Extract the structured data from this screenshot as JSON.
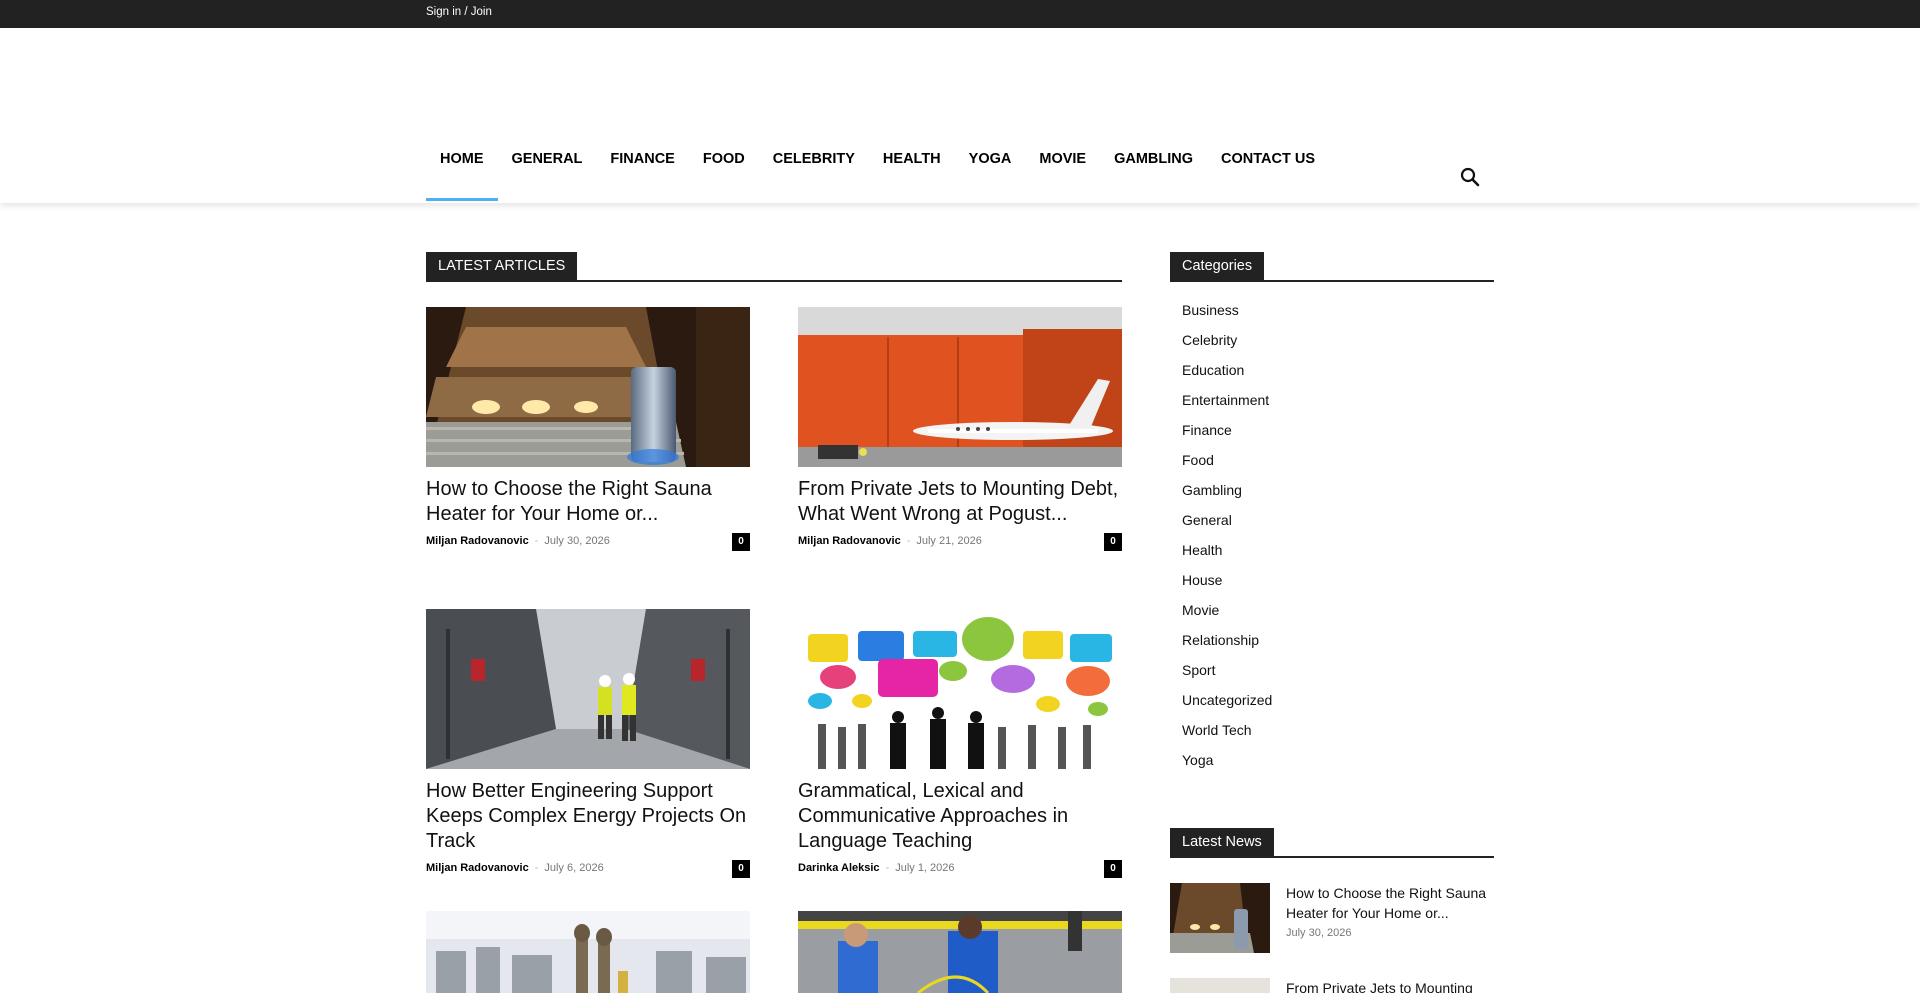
{
  "topbar": {
    "signin_label": "Sign in / Join"
  },
  "nav": {
    "items": [
      {
        "label": "HOME"
      },
      {
        "label": "GENERAL"
      },
      {
        "label": "FINANCE"
      },
      {
        "label": "FOOD"
      },
      {
        "label": "CELEBRITY"
      },
      {
        "label": "HEALTH"
      },
      {
        "label": "YOGA"
      },
      {
        "label": "MOVIE"
      },
      {
        "label": "GAMBLING"
      },
      {
        "label": "CONTACT US"
      }
    ],
    "search_icon": "search-icon"
  },
  "latest": {
    "title": "LATEST ARTICLES",
    "articles": [
      {
        "title": "How to Choose the Right Sauna Heater for Your Home or...",
        "author": "Miljan Radovanovic",
        "date": "July 30, 2026",
        "comments": "0"
      },
      {
        "title": "From Private Jets to Mounting Debt, What Went Wrong at Pogust...",
        "author": "Miljan Radovanovic",
        "date": "July 21, 2026",
        "comments": "0"
      },
      {
        "title": "How Better Engineering Support Keeps Complex Energy Projects On Track",
        "author": "Miljan Radovanovic",
        "date": "July 6, 2026",
        "comments": "0"
      },
      {
        "title": "Grammatical, Lexical and Communicative Approaches in Language Teaching",
        "author": "Darinka Aleksic",
        "date": "July 1, 2026",
        "comments": "0"
      }
    ]
  },
  "sidebar": {
    "categories_title": "Categories",
    "categories": [
      "Business",
      "Celebrity",
      "Education",
      "Entertainment",
      "Finance",
      "Food",
      "Gambling",
      "General",
      "Health",
      "House",
      "Movie",
      "Relationship",
      "Sport",
      "Uncategorized",
      "World Tech",
      "Yoga"
    ],
    "latest_news_title": "Latest News",
    "news": [
      {
        "title": "How to Choose the Right Sauna Heater for Your Home or...",
        "date": "July 30, 2026"
      },
      {
        "title": "From Private Jets to Mounting",
        "date": ""
      }
    ]
  },
  "colors": {
    "accent": "#4db2ec",
    "dark": "#222222"
  }
}
